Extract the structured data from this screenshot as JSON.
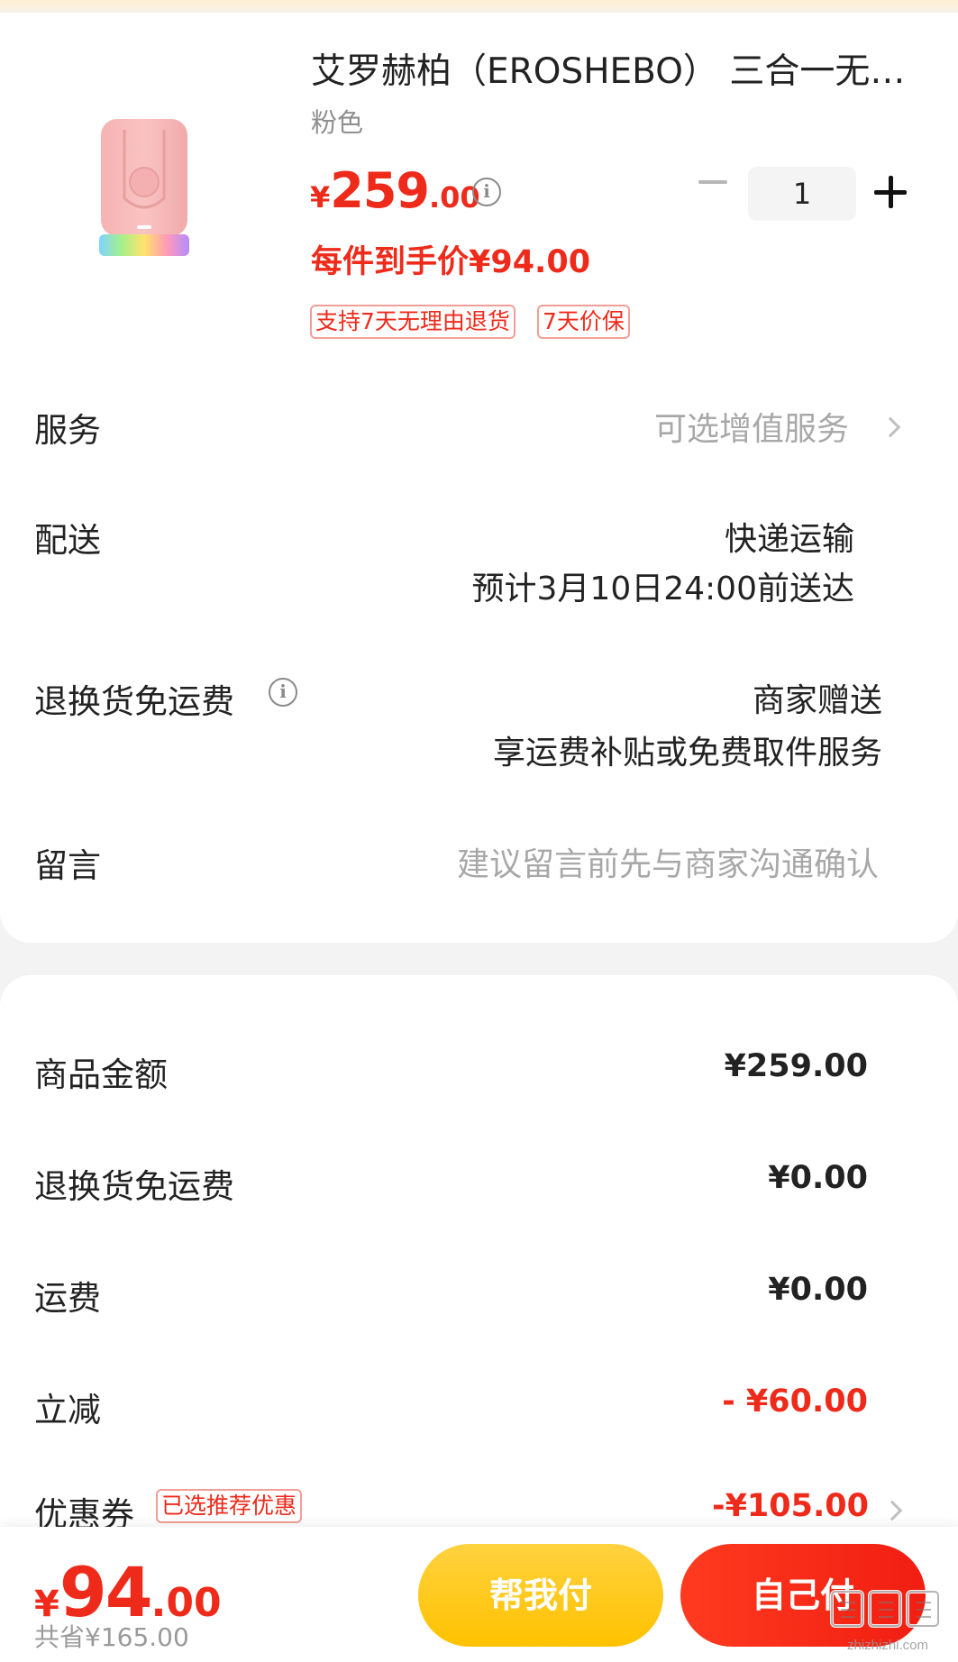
{
  "product": {
    "title": "艾罗赫柏（EROSHEBO） 三合一无…",
    "variant": "粉色",
    "price_symbol": "¥",
    "price_int": "259",
    "price_dec": ".00",
    "quantity": "1",
    "unit_price_text": "每件到手价¥94.00",
    "tags": [
      "支持7天无理由退货",
      "7天价保"
    ]
  },
  "rows": {
    "service_label": "服务",
    "service_value": "可选增值服务",
    "delivery_label": "配送",
    "delivery_method": "快递运输",
    "delivery_eta": "预计3月10日24:00前送达",
    "return_label": "退换货免运费",
    "return_value1": "商家赠送",
    "return_value2": "享运费补贴或免费取件服务",
    "note_label": "留言",
    "note_placeholder": "建议留言前先与商家沟通确认"
  },
  "summary": {
    "goods_label": "商品金额",
    "goods_value": "¥259.00",
    "return_label": "退换货免运费",
    "return_value": "¥0.00",
    "shipping_label": "运费",
    "shipping_value": "¥0.00",
    "discount_label": "立减",
    "discount_value": "- ¥60.00",
    "coupon_label": "优惠券",
    "coupon_tag": "已选推荐优惠",
    "coupon_value": "-¥105.00"
  },
  "footer": {
    "total_symbol": "¥",
    "total_int": "94",
    "total_dec": ".00",
    "saved_text": "共省¥165.00",
    "help_pay_label": "帮我付",
    "self_pay_label": "自己付"
  },
  "watermark": {
    "brand": "值值值",
    "domain": "zhizhizhi.com"
  },
  "colors": {
    "accent_red": "#ee2a1b",
    "help_yellow": "#ffc200",
    "muted_gray": "#a8a8a8"
  }
}
